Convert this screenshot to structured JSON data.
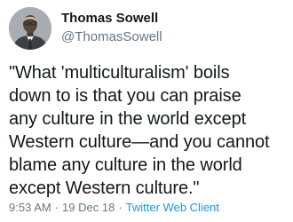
{
  "author": {
    "display_name": "Thomas Sowell",
    "handle": "@ThomasSowell"
  },
  "tweet": {
    "lines": [
      "\"What 'multiculturalism' boils",
      "down to is that you can praise",
      "any culture in the world except",
      "Western culture—and you cannot",
      "blame any culture in the world",
      "except Western culture.\""
    ]
  },
  "meta": {
    "time": "9:53 AM",
    "separator": "·",
    "date": "19 Dec 18",
    "source": "Twitter Web Client"
  },
  "colors": {
    "text": "#14171a",
    "secondary": "#657786",
    "link": "#1b95e0"
  },
  "icons": {
    "avatar": "profile-photo"
  }
}
